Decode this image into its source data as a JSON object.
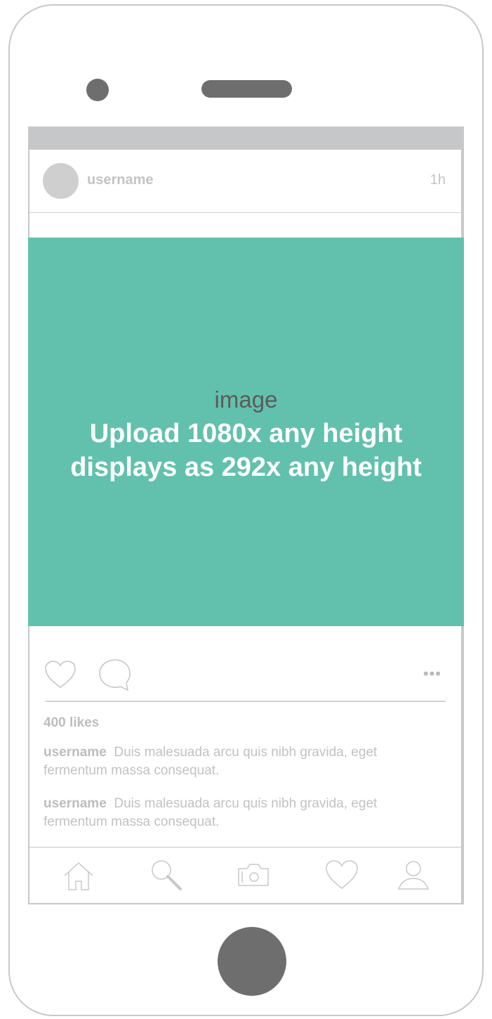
{
  "post": {
    "username": "username",
    "time": "1h"
  },
  "image": {
    "label": "image",
    "line1": "Upload  1080x any height",
    "line2": "displays as 292x any height",
    "color": "#61c1ad"
  },
  "actions": {
    "like_icon": "heart-icon",
    "comment_icon": "comment-icon",
    "more": "•••"
  },
  "likes": "400 likes",
  "comments": [
    {
      "username": "username",
      "text": "Duis malesuada arcu quis nibh gravida, eget fermentum massa consequat."
    },
    {
      "username": "username",
      "text": "Duis malesuada arcu quis nibh gravida, eget fermentum massa consequat."
    }
  ],
  "tabbar": [
    "home-icon",
    "search-icon",
    "camera-icon",
    "heart-icon",
    "profile-icon"
  ]
}
